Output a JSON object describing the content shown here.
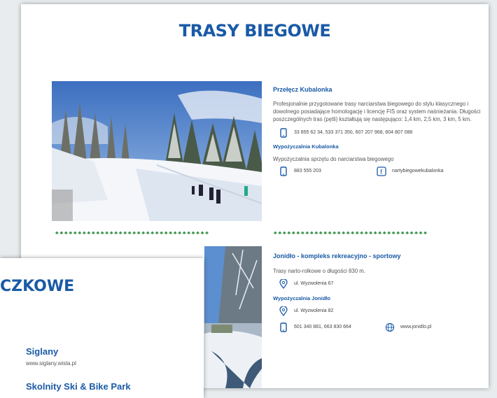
{
  "page": {
    "title": "TRASY BIEGOWE"
  },
  "section1": {
    "heading": "Przełęcz Kubalonka",
    "description": "Profesjonalnie przygotowane trasy narciarstwa biegowego do stylu klasycznego i dowolnego posiadające homologację i licencję FIS oraz system naśnieżania. Długości poszczególnych tras (pętli) kształtują się następująco: 1,4 km, 2,5 km, 3 km, 5 km.",
    "phones": "33 855 62 34, 533 371 350, 607 207 968, 604 807 088",
    "rental_heading": "Wypożyczalnia Kubalonka",
    "rental_text": "Wypożyczalnia sprzętu do narciarstwa biegowego",
    "rental_phone": "883 555 203",
    "facebook": "nartybiegowekubalonka"
  },
  "divider": "♣♣♣♣♣♣♣♣♣♣♣♣♣♣♣♣♣♣♣♣♣♣♣♣♣♣♣♣♣♣♣♣♣♣",
  "section2": {
    "heading": "Jonidło - kompleks rekreacyjno - sportowy",
    "description": "Trasy narto-rolkowe o długości 830 m.",
    "address": "ul. Wyzwolenia 67",
    "rental_heading": "Wypożyczalnia Jonidło",
    "rental_address": "ul. Wyzwolenia 82",
    "phones": "601 340 881, 663 830 664",
    "website": "www.jonidlo.pl"
  },
  "front_page": {
    "title": "CZKOWE",
    "place": "Siglany",
    "url": "www.siglany.wisla.pl",
    "next_place": "Skolnity Ski & Bike Park"
  },
  "colors": {
    "accent": "#1a5aa6",
    "tree_green": "#2e8b3e"
  }
}
